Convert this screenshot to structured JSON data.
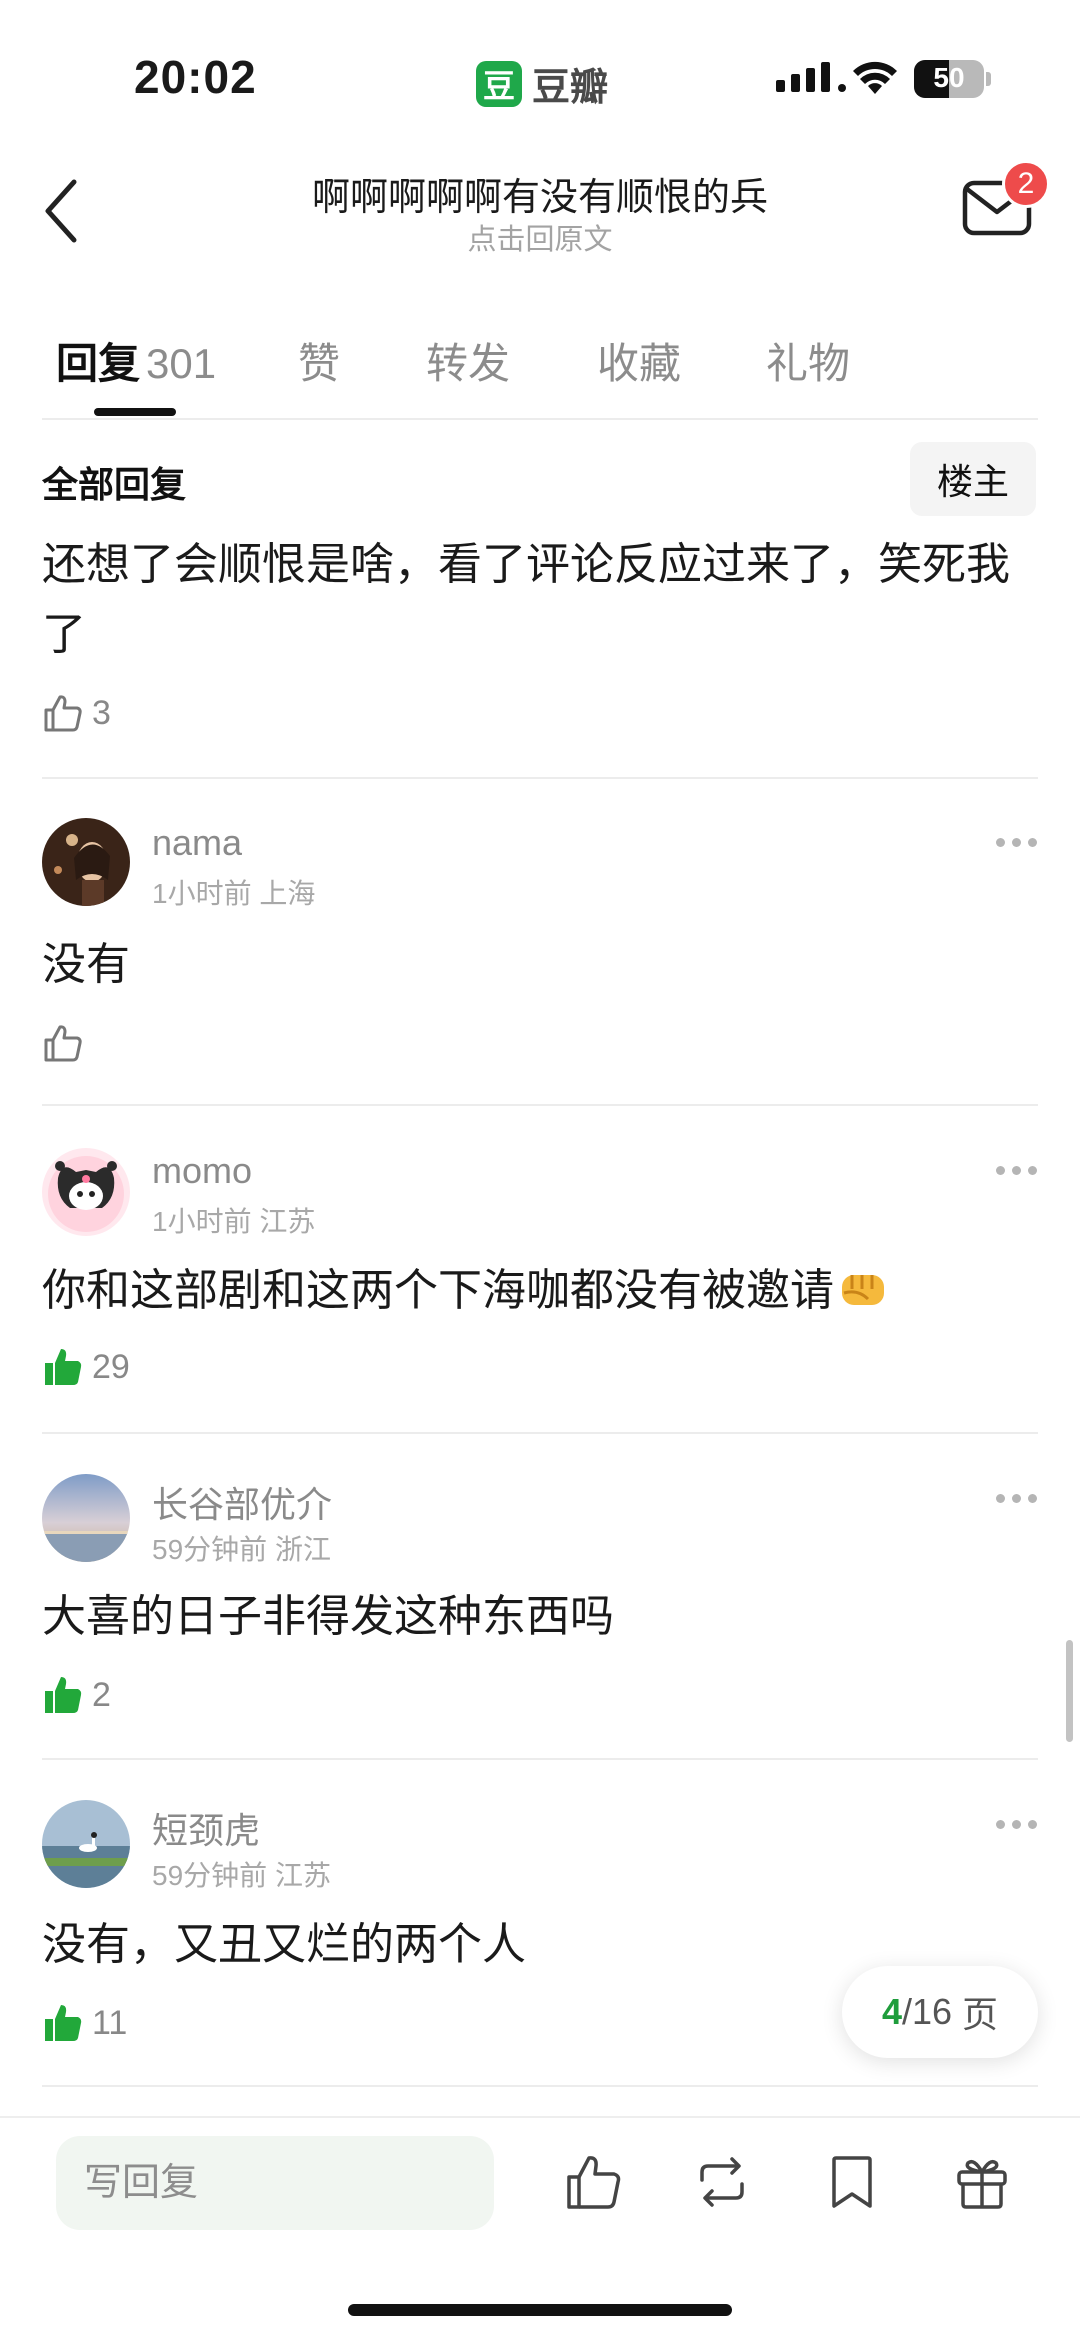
{
  "status_bar": {
    "time": "20:02",
    "app_logo_char": "豆",
    "app_name": "豆瓣",
    "battery": "50",
    "battery_level": 0.5
  },
  "nav": {
    "title": "啊啊啊啊啊有没有顺恨的兵",
    "subtitle": "点击回原文",
    "mail_badge": "2"
  },
  "tabs": [
    {
      "label": "回复",
      "count": "301",
      "active": true
    },
    {
      "label": "赞"
    },
    {
      "label": "转发"
    },
    {
      "label": "收藏"
    },
    {
      "label": "礼物"
    }
  ],
  "section": {
    "title": "全部回复",
    "sort_button": "楼主"
  },
  "first_comment": {
    "text": "还想了会顺恨是啥，看了评论反应过来了，笑死我了",
    "likes": "3"
  },
  "comments": [
    {
      "username": "nama",
      "time": "1小时前",
      "location": "上海",
      "text": "没有",
      "likes": "",
      "liked": false
    },
    {
      "username": "momo",
      "time": "1小时前",
      "location": "江苏",
      "text": "你和这部剧和这两个下海咖都没有被邀请",
      "emoji": "fist-emoji",
      "likes": "29",
      "liked": true
    },
    {
      "username": "长谷部优介",
      "time": "59分钟前",
      "location": "浙江",
      "text": "大喜的日子非得发这种东西吗",
      "likes": "2",
      "liked": true
    },
    {
      "username": "短颈虎",
      "time": "59分钟前",
      "location": "江苏",
      "text": "没有，又丑又烂的两个人",
      "likes": "11",
      "liked": true
    }
  ],
  "pager": {
    "current": "4",
    "total": "/16",
    "unit": "页"
  },
  "bottom_bar": {
    "reply_placeholder": "写回复",
    "icons": [
      "thumbs-up-icon",
      "repost-icon",
      "bookmark-icon",
      "gift-icon"
    ]
  },
  "colors": {
    "accent_green": "#1f9d3c",
    "like_green": "#22a83a",
    "badge_red": "#ee4b4b"
  }
}
